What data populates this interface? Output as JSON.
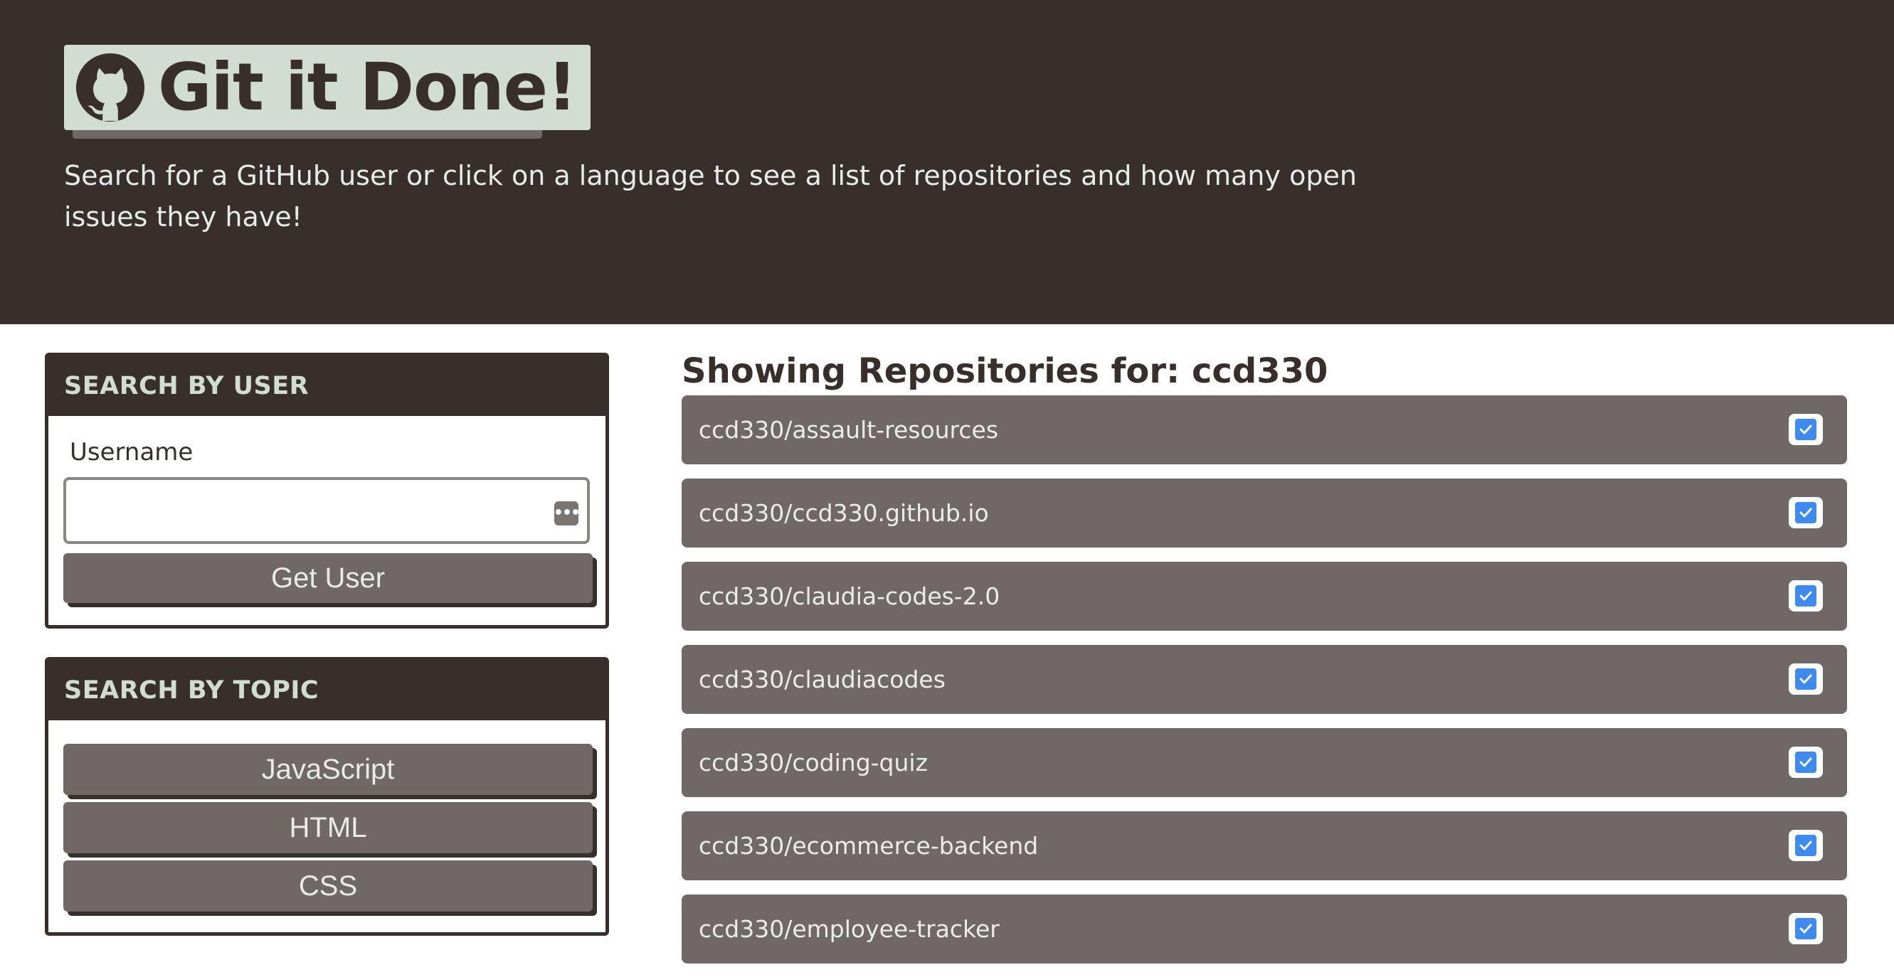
{
  "header": {
    "title": "Git it Done!",
    "subtitle": "Search for a GitHub user or click on a language to see a list of repositories and how many open issues they have!",
    "logo_icon": "github-icon"
  },
  "user_search": {
    "heading": "SEARCH BY USER",
    "label": "Username",
    "value": "",
    "button_label": "Get User"
  },
  "topic_search": {
    "heading": "SEARCH BY TOPIC",
    "topics": [
      "JavaScript",
      "HTML",
      "CSS"
    ]
  },
  "repos": {
    "heading": "Showing Repositories for: ccd330",
    "items": [
      {
        "name": "ccd330/assault-resources",
        "status_icon": "check-square-icon"
      },
      {
        "name": "ccd330/ccd330.github.io",
        "status_icon": "check-square-icon"
      },
      {
        "name": "ccd330/claudia-codes-2.0",
        "status_icon": "check-square-icon"
      },
      {
        "name": "ccd330/claudiacodes",
        "status_icon": "check-square-icon"
      },
      {
        "name": "ccd330/coding-quiz",
        "status_icon": "check-square-icon"
      },
      {
        "name": "ccd330/ecommerce-backend",
        "status_icon": "check-square-icon"
      },
      {
        "name": "ccd330/employee-tracker",
        "status_icon": "check-square-icon"
      }
    ]
  },
  "colors": {
    "header_bg": "#382f2d",
    "logo_bg": "#d0dcd4",
    "item_bg": "#6f6866",
    "check_blue": "#3d8af0"
  }
}
